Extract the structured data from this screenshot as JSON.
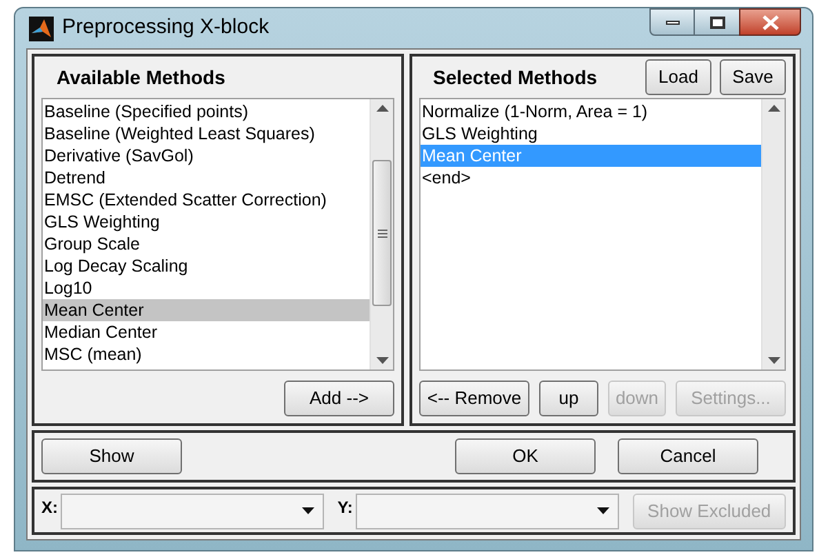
{
  "window": {
    "title": "Preprocessing X-block"
  },
  "available": {
    "title": "Available Methods",
    "items": [
      {
        "label": "Baseline (Specified points)",
        "selected": false
      },
      {
        "label": "Baseline (Weighted Least Squares)",
        "selected": false
      },
      {
        "label": "Derivative (SavGol)",
        "selected": false
      },
      {
        "label": "Detrend",
        "selected": false
      },
      {
        "label": "EMSC (Extended Scatter Correction)",
        "selected": false
      },
      {
        "label": "GLS Weighting",
        "selected": false
      },
      {
        "label": "Group Scale",
        "selected": false
      },
      {
        "label": "Log Decay Scaling",
        "selected": false
      },
      {
        "label": "Log10",
        "selected": false
      },
      {
        "label": "Mean Center",
        "selected": true
      },
      {
        "label": "Median Center",
        "selected": false
      },
      {
        "label": "MSC (mean)",
        "selected": false
      }
    ],
    "buttons": [
      {
        "label": "Add -->",
        "disabled": false
      }
    ]
  },
  "selected_methods": {
    "title": "Selected Methods",
    "header_buttons": [
      {
        "label": "Load",
        "disabled": false
      },
      {
        "label": "Save",
        "disabled": false
      }
    ],
    "items": [
      {
        "label": "Normalize (1-Norm, Area = 1)",
        "selected": false
      },
      {
        "label": "GLS Weighting",
        "selected": false
      },
      {
        "label": "Mean Center",
        "selected": true
      },
      {
        "label": "<end>",
        "selected": false
      }
    ],
    "buttons": [
      {
        "label": "<-- Remove",
        "disabled": false
      },
      {
        "label": "up",
        "disabled": false
      },
      {
        "label": "down",
        "disabled": true
      },
      {
        "label": "Settings...",
        "disabled": true
      }
    ]
  },
  "actions": [
    {
      "label": "Show",
      "disabled": false
    },
    {
      "label": "OK",
      "disabled": false
    },
    {
      "label": "Cancel",
      "disabled": false
    }
  ],
  "axes": {
    "fields": [
      {
        "label": "X:"
      },
      {
        "label": "Y:"
      }
    ],
    "button": {
      "label": "Show Excluded",
      "disabled": true
    }
  }
}
